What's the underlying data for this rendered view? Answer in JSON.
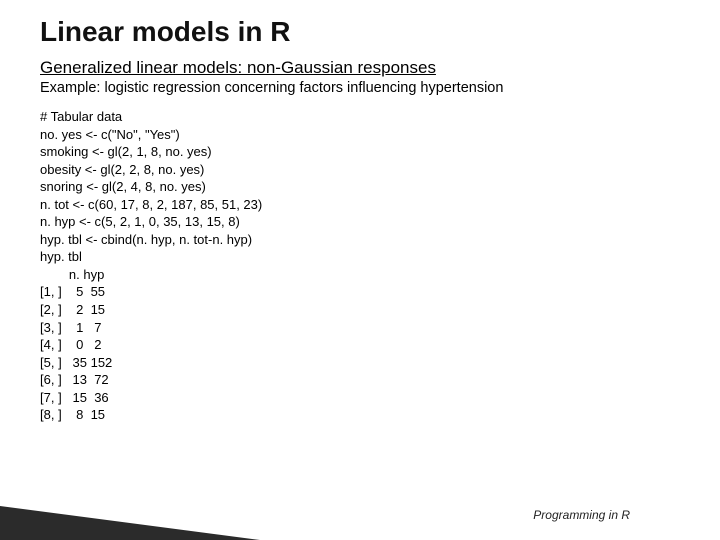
{
  "title": "Linear models in R",
  "subtitle": "Generalized linear models: non-Gaussian responses",
  "example": "Example: logistic regression concerning factors influencing hypertension",
  "code": "# Tabular data\nno. yes <- c(\"No\", \"Yes\")\nsmoking <- gl(2, 1, 8, no. yes)\nobesity <- gl(2, 2, 8, no. yes)\nsnoring <- gl(2, 4, 8, no. yes)\nn. tot <- c(60, 17, 8, 2, 187, 85, 51, 23)\nn. hyp <- c(5, 2, 1, 0, 35, 13, 15, 8)\nhyp. tbl <- cbind(n. hyp, n. tot-n. hyp)\nhyp. tbl\n        n. hyp\n[1, ]    5  55\n[2, ]    2  15\n[3, ]    1   7\n[4, ]    0   2\n[5, ]   35 152\n[6, ]   13  72\n[7, ]   15  36\n[8, ]    8  15",
  "footer": "Programming in R"
}
